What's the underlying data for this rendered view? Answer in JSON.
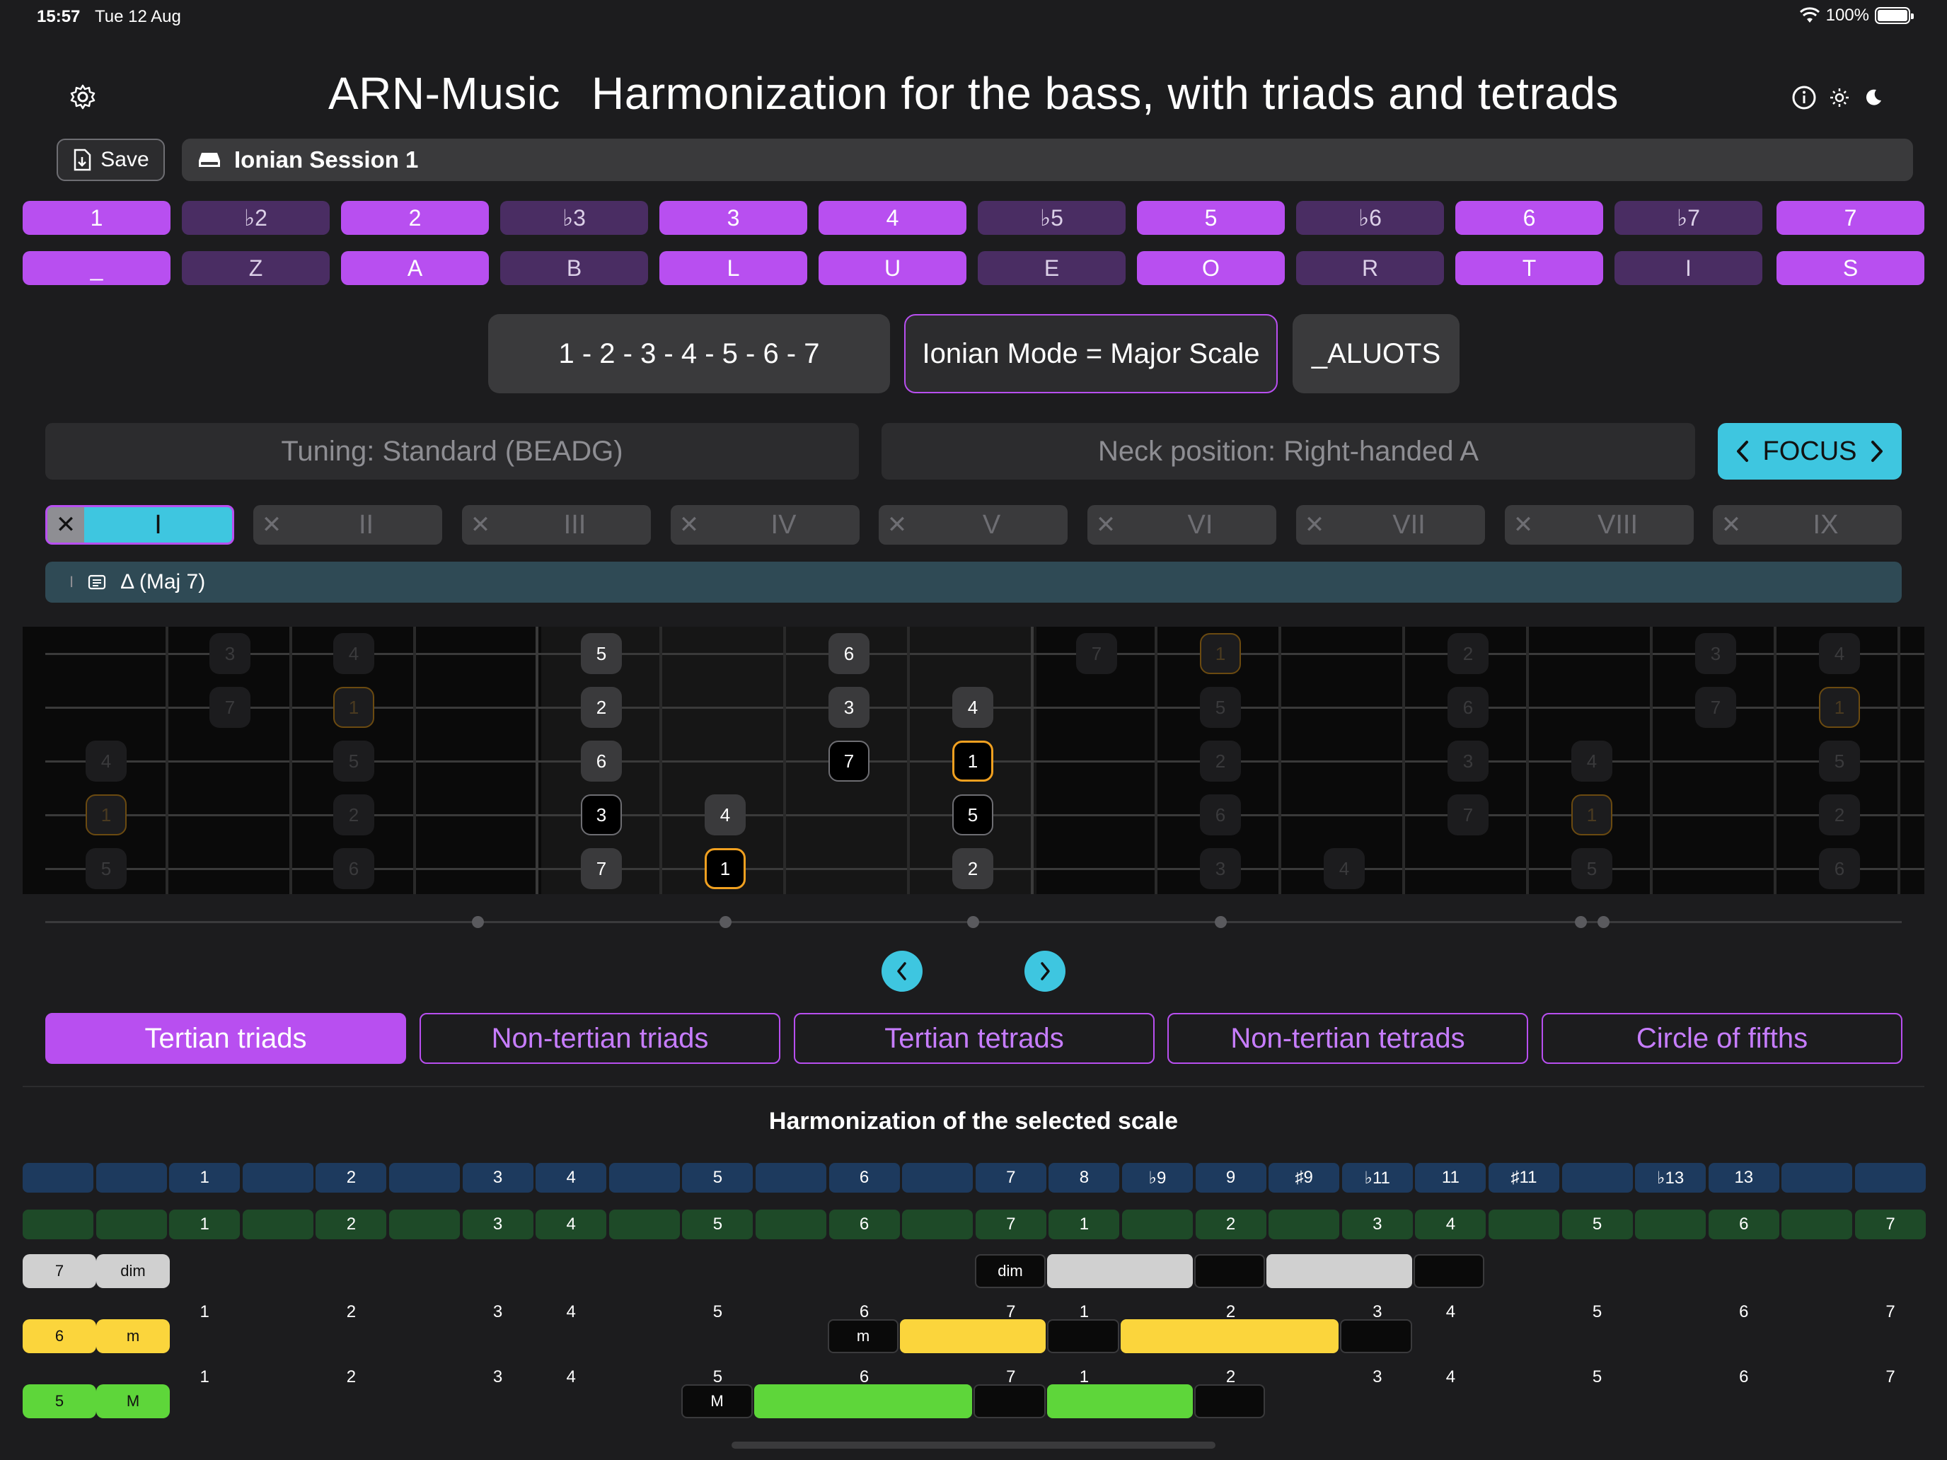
{
  "status": {
    "time": "15:57",
    "date": "Tue 12 Aug",
    "battery": "100%"
  },
  "header": {
    "app_name": "ARN-Music",
    "title": "Harmonization for the bass, with triads and tetrads"
  },
  "toolbar": {
    "save_label": "Save",
    "session_name": "Ionian Session 1"
  },
  "degrees": [
    {
      "label": "1",
      "active": true
    },
    {
      "label": "♭2",
      "active": false
    },
    {
      "label": "2",
      "active": true
    },
    {
      "label": "♭3",
      "active": false
    },
    {
      "label": "3",
      "active": true
    },
    {
      "label": "4",
      "active": true
    },
    {
      "label": "♭5",
      "active": false
    },
    {
      "label": "5",
      "active": true
    },
    {
      "label": "♭6",
      "active": false
    },
    {
      "label": "6",
      "active": true
    },
    {
      "label": "♭7",
      "active": false
    },
    {
      "label": "7",
      "active": true
    }
  ],
  "letters": [
    {
      "label": "_",
      "active": true
    },
    {
      "label": "Z",
      "active": false
    },
    {
      "label": "A",
      "active": true
    },
    {
      "label": "B",
      "active": false
    },
    {
      "label": "L",
      "active": true
    },
    {
      "label": "U",
      "active": true
    },
    {
      "label": "E",
      "active": false
    },
    {
      "label": "O",
      "active": true
    },
    {
      "label": "R",
      "active": false
    },
    {
      "label": "T",
      "active": true
    },
    {
      "label": "I",
      "active": false
    },
    {
      "label": "S",
      "active": true
    }
  ],
  "scale": {
    "formula": "1 - 2 - 3 - 4 - 5 - 6 - 7",
    "name": "Ionian Mode = Major Scale",
    "code": "_ALUOTS"
  },
  "settings": {
    "tuning": "Tuning: Standard (BEADG)",
    "neck": "Neck position: Right-handed A",
    "focus_label": "FOCUS"
  },
  "chord_tabs": [
    "I",
    "II",
    "III",
    "IV",
    "V",
    "VI",
    "VII",
    "VIII",
    "IX"
  ],
  "selected_chord": {
    "index": "I",
    "symbol": "Δ (Maj 7)"
  },
  "fretboard": {
    "notes": [
      {
        "s": 0,
        "f": 1,
        "t": "3",
        "k": "dim"
      },
      {
        "s": 0,
        "f": 2,
        "t": "4",
        "k": "dim"
      },
      {
        "s": 0,
        "f": 4,
        "t": "5",
        "k": "gray"
      },
      {
        "s": 0,
        "f": 6,
        "t": "6",
        "k": "gray"
      },
      {
        "s": 0,
        "f": 8,
        "t": "7",
        "k": "dim"
      },
      {
        "s": 0,
        "f": 9,
        "t": "1",
        "k": "dimroot"
      },
      {
        "s": 0,
        "f": 11,
        "t": "2",
        "k": "dim"
      },
      {
        "s": 0,
        "f": 13,
        "t": "3",
        "k": "dim"
      },
      {
        "s": 0,
        "f": 14,
        "t": "4",
        "k": "dim"
      },
      {
        "s": 1,
        "f": 1,
        "t": "7",
        "k": "dim"
      },
      {
        "s": 1,
        "f": 2,
        "t": "1",
        "k": "dimroot"
      },
      {
        "s": 1,
        "f": 4,
        "t": "2",
        "k": "gray"
      },
      {
        "s": 1,
        "f": 6,
        "t": "3",
        "k": "gray"
      },
      {
        "s": 1,
        "f": 7,
        "t": "4",
        "k": "gray"
      },
      {
        "s": 1,
        "f": 9,
        "t": "5",
        "k": "dim"
      },
      {
        "s": 1,
        "f": 11,
        "t": "6",
        "k": "dim"
      },
      {
        "s": 1,
        "f": 13,
        "t": "7",
        "k": "dim"
      },
      {
        "s": 1,
        "f": 14,
        "t": "1",
        "k": "dimroot"
      },
      {
        "s": 2,
        "f": 0,
        "t": "4",
        "k": "dim"
      },
      {
        "s": 2,
        "f": 2,
        "t": "5",
        "k": "dim"
      },
      {
        "s": 2,
        "f": 4,
        "t": "6",
        "k": "gray"
      },
      {
        "s": 2,
        "f": 6,
        "t": "7",
        "k": "black"
      },
      {
        "s": 2,
        "f": 7,
        "t": "1",
        "k": "root"
      },
      {
        "s": 2,
        "f": 9,
        "t": "2",
        "k": "dim"
      },
      {
        "s": 2,
        "f": 11,
        "t": "3",
        "k": "dim"
      },
      {
        "s": 2,
        "f": 12,
        "t": "4",
        "k": "dim"
      },
      {
        "s": 2,
        "f": 14,
        "t": "5",
        "k": "dim"
      },
      {
        "s": 3,
        "f": 0,
        "t": "1",
        "k": "dimroot"
      },
      {
        "s": 3,
        "f": 2,
        "t": "2",
        "k": "dim"
      },
      {
        "s": 3,
        "f": 4,
        "t": "3",
        "k": "black"
      },
      {
        "s": 3,
        "f": 5,
        "t": "4",
        "k": "gray"
      },
      {
        "s": 3,
        "f": 7,
        "t": "5",
        "k": "black"
      },
      {
        "s": 3,
        "f": 9,
        "t": "6",
        "k": "dim"
      },
      {
        "s": 3,
        "f": 11,
        "t": "7",
        "k": "dim"
      },
      {
        "s": 3,
        "f": 12,
        "t": "1",
        "k": "dimroot"
      },
      {
        "s": 3,
        "f": 14,
        "t": "2",
        "k": "dim"
      },
      {
        "s": 4,
        "f": 0,
        "t": "5",
        "k": "dim"
      },
      {
        "s": 4,
        "f": 2,
        "t": "6",
        "k": "dim"
      },
      {
        "s": 4,
        "f": 4,
        "t": "7",
        "k": "gray"
      },
      {
        "s": 4,
        "f": 5,
        "t": "1",
        "k": "root"
      },
      {
        "s": 4,
        "f": 7,
        "t": "2",
        "k": "gray"
      },
      {
        "s": 4,
        "f": 9,
        "t": "3",
        "k": "dim"
      },
      {
        "s": 4,
        "f": 10,
        "t": "4",
        "k": "dim"
      },
      {
        "s": 4,
        "f": 12,
        "t": "5",
        "k": "dim"
      },
      {
        "s": 4,
        "f": 14,
        "t": "6",
        "k": "dim"
      }
    ]
  },
  "modes": [
    "Tertian triads",
    "Non-tertian triads",
    "Tertian tetrads",
    "Non-tertian tetrads",
    "Circle of fifths"
  ],
  "harmonization": {
    "title": "Harmonization of the selected scale",
    "intervals": [
      "",
      "",
      "1",
      "",
      "2",
      "",
      "3",
      "4",
      "",
      "5",
      "",
      "6",
      "",
      "7",
      "8",
      "♭9",
      "9",
      "♯9",
      "♭11",
      "11",
      "♯11",
      "",
      "♭13",
      "13",
      "",
      ""
    ],
    "degrees": [
      "",
      "",
      "1",
      "",
      "2",
      "",
      "3",
      "4",
      "",
      "5",
      "",
      "6",
      "",
      "7",
      "1",
      "",
      "2",
      "",
      "3",
      "4",
      "",
      "5",
      "",
      "6",
      "",
      "7"
    ],
    "rows": [
      {
        "degree": "7",
        "quality": "dim",
        "marker": "dim",
        "color": "#d0d0d0",
        "numbers": [
          "1",
          "2",
          "3",
          "4",
          "5",
          "6",
          "7",
          "1",
          "2",
          "3",
          "4",
          "5",
          "6",
          "7"
        ]
      },
      {
        "degree": "6",
        "quality": "m",
        "marker": "m",
        "color": "#fbd53c",
        "numbers": [
          "1",
          "2",
          "3",
          "4",
          "5",
          "6",
          "7",
          "1",
          "2",
          "3",
          "4",
          "5",
          "6",
          "7"
        ]
      },
      {
        "degree": "5",
        "quality": "M",
        "marker": "M",
        "color": "#5ed63a"
      }
    ]
  }
}
